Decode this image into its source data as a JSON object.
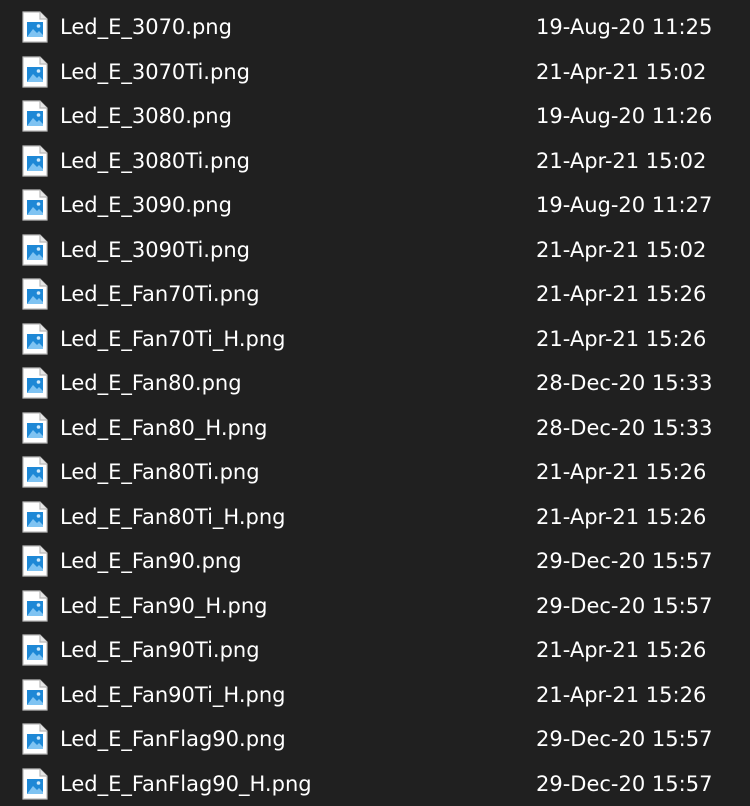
{
  "colors": {
    "background": "#202020",
    "text": "#ffffff",
    "icon_page": "#ffffff",
    "icon_border": "#b9b9b9",
    "icon_image": "#1e88d6"
  },
  "icon_name": "image-file-icon",
  "files": [
    {
      "name": "Led_E_3070.png",
      "modified": "19-Aug-20 11:25"
    },
    {
      "name": "Led_E_3070Ti.png",
      "modified": "21-Apr-21 15:02"
    },
    {
      "name": "Led_E_3080.png",
      "modified": "19-Aug-20 11:26"
    },
    {
      "name": "Led_E_3080Ti.png",
      "modified": "21-Apr-21 15:02"
    },
    {
      "name": "Led_E_3090.png",
      "modified": "19-Aug-20 11:27"
    },
    {
      "name": "Led_E_3090Ti.png",
      "modified": "21-Apr-21 15:02"
    },
    {
      "name": "Led_E_Fan70Ti.png",
      "modified": "21-Apr-21 15:26"
    },
    {
      "name": "Led_E_Fan70Ti_H.png",
      "modified": "21-Apr-21 15:26"
    },
    {
      "name": "Led_E_Fan80.png",
      "modified": "28-Dec-20 15:33"
    },
    {
      "name": "Led_E_Fan80_H.png",
      "modified": "28-Dec-20 15:33"
    },
    {
      "name": "Led_E_Fan80Ti.png",
      "modified": "21-Apr-21 15:26"
    },
    {
      "name": "Led_E_Fan80Ti_H.png",
      "modified": "21-Apr-21 15:26"
    },
    {
      "name": "Led_E_Fan90.png",
      "modified": "29-Dec-20 15:57"
    },
    {
      "name": "Led_E_Fan90_H.png",
      "modified": "29-Dec-20 15:57"
    },
    {
      "name": "Led_E_Fan90Ti.png",
      "modified": "21-Apr-21 15:26"
    },
    {
      "name": "Led_E_Fan90Ti_H.png",
      "modified": "21-Apr-21 15:26"
    },
    {
      "name": "Led_E_FanFlag90.png",
      "modified": "29-Dec-20 15:57"
    },
    {
      "name": "Led_E_FanFlag90_H.png",
      "modified": "29-Dec-20 15:57"
    }
  ]
}
